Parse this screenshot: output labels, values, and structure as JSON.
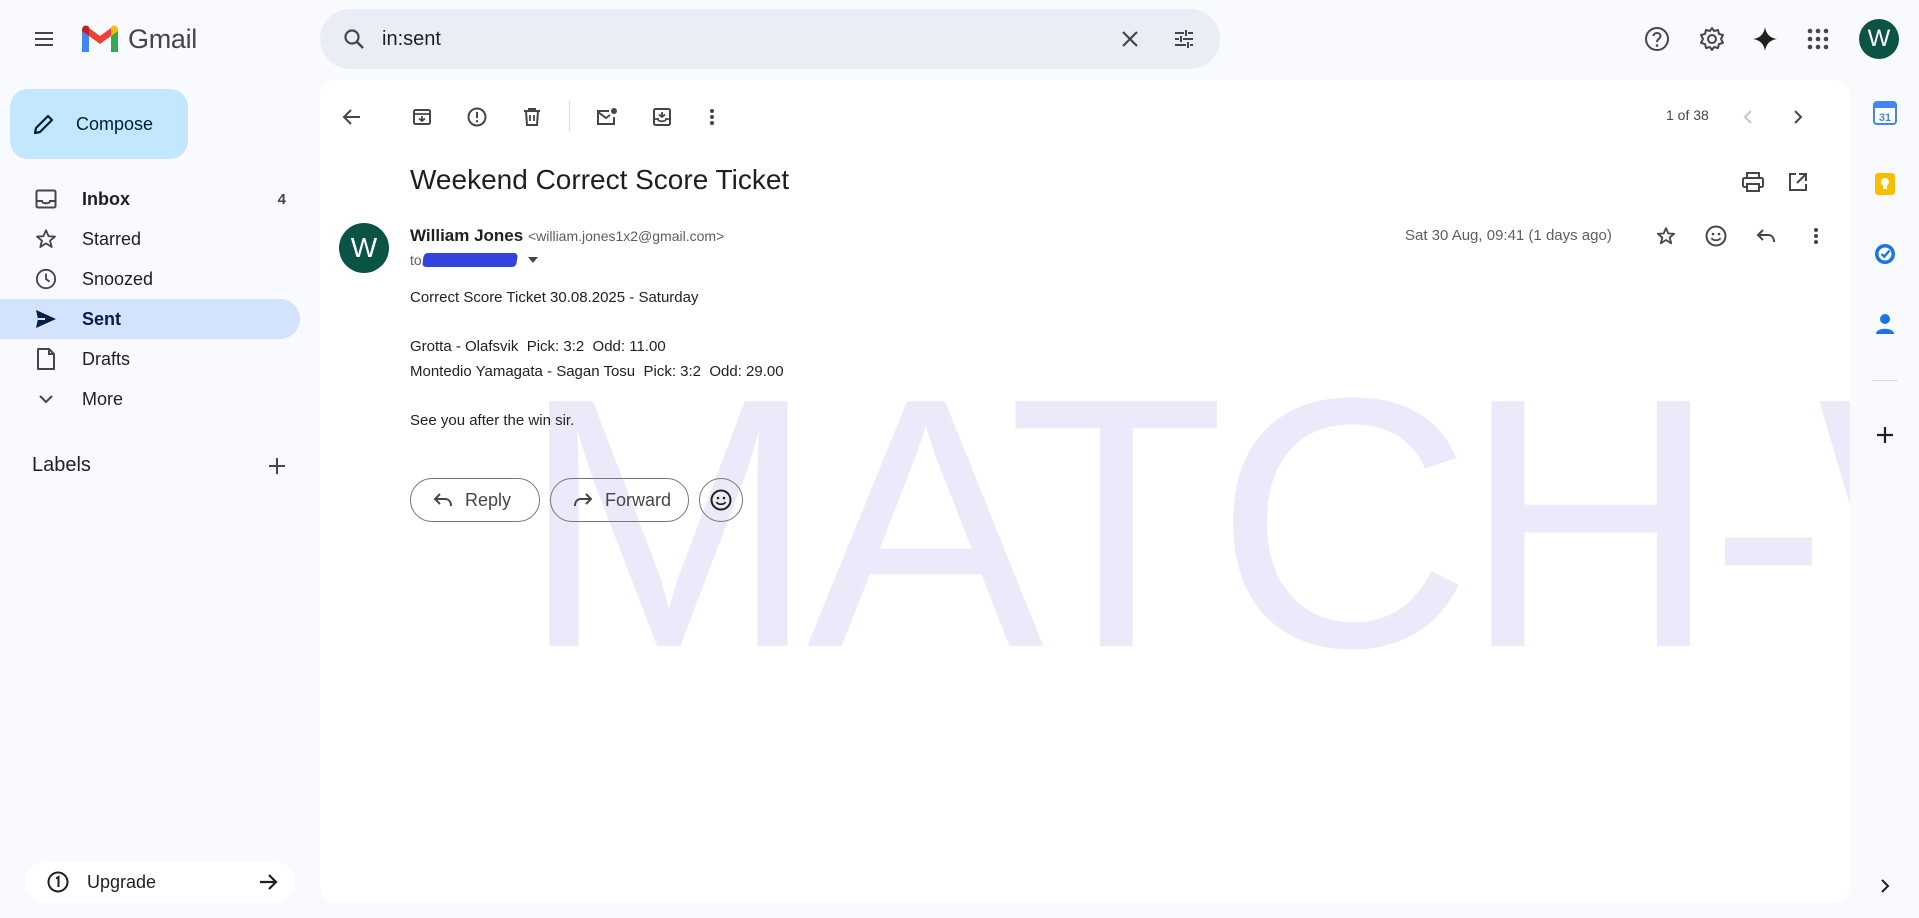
{
  "app": {
    "name": "Gmail"
  },
  "search": {
    "value": "in:sent"
  },
  "header": {
    "avatar_letter": "W"
  },
  "compose": {
    "label": "Compose"
  },
  "nav": {
    "inbox": {
      "label": "Inbox",
      "count": "4"
    },
    "starred": {
      "label": "Starred"
    },
    "snoozed": {
      "label": "Snoozed"
    },
    "sent": {
      "label": "Sent"
    },
    "drafts": {
      "label": "Drafts"
    },
    "more": {
      "label": "More"
    }
  },
  "labels": {
    "title": "Labels"
  },
  "upgrade": {
    "label": "Upgrade"
  },
  "toolbar": {
    "pager": "1 of 38"
  },
  "email": {
    "subject": "Weekend Correct Score Ticket",
    "sender_initial": "W",
    "sender_name": "William Jones",
    "sender_email": "<william.jones1x2@gmail.com>",
    "to_prefix": "to",
    "date": "Sat 30 Aug, 09:41 (1 days ago)",
    "body": {
      "line1": "Correct Score Ticket 30.08.2025 - Saturday",
      "line2": "Grotta - Olafsvik  Pick: 3:2  Odd: 11.00",
      "line3": "Montedio Yamagata - Sagan Tosu  Pick: 3:2  Odd: 29.00",
      "line4": "See you after the win sir."
    },
    "watermark": "MATCH-WIN"
  },
  "actions": {
    "reply": "Reply",
    "forward": "Forward"
  },
  "colors": {
    "accent": "#0b57d0",
    "compose_bg": "#c2e7ff",
    "active_nav": "#d3e3fd",
    "avatar": "#0b5345"
  }
}
